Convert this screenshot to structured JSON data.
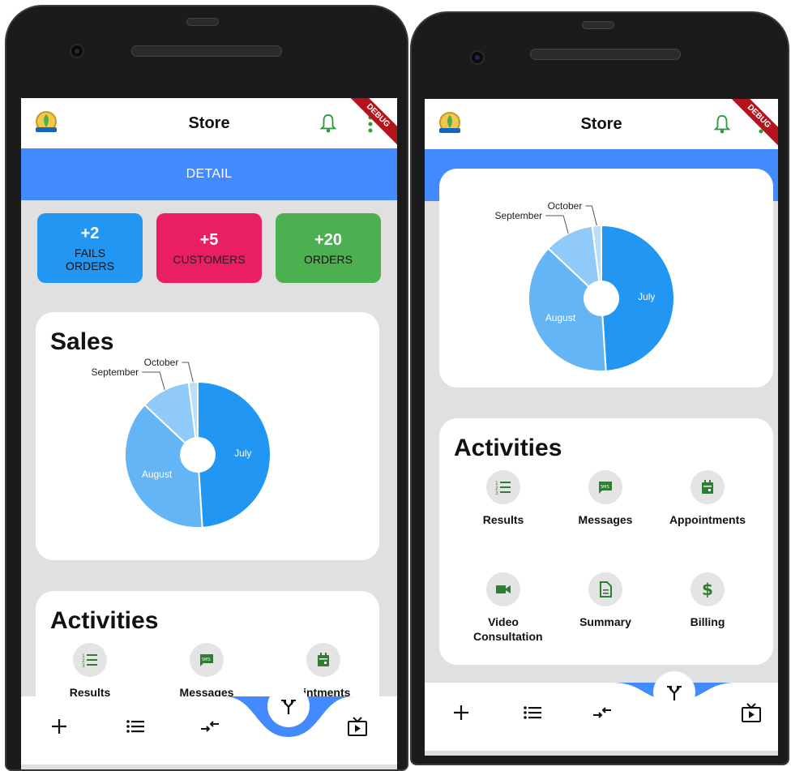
{
  "app": {
    "title": "Store",
    "debug_banner": "DEBUG",
    "detail_tab": "DETAIL"
  },
  "stats": [
    {
      "value": "+2",
      "label": "FAILS ORDERS",
      "color": "#2196f3"
    },
    {
      "value": "+5",
      "label": "CUSTOMERS",
      "color": "#e91e63"
    },
    {
      "value": "+20",
      "label": "ORDERS",
      "color": "#4caf50"
    }
  ],
  "sales": {
    "title": "Sales"
  },
  "chart_data": {
    "type": "pie",
    "title": "Sales",
    "categories": [
      "July",
      "August",
      "September",
      "October"
    ],
    "values": [
      49,
      38,
      11,
      2
    ],
    "colors": [
      "#2196f3",
      "#64b5f6",
      "#90caf9",
      "#bbdefb"
    ],
    "donut_hole": true
  },
  "activities": {
    "title": "Activities",
    "items": [
      {
        "label": "Results",
        "icon": "list-numbered-icon"
      },
      {
        "label": "Messages",
        "icon": "sms-icon"
      },
      {
        "label": "Appointments",
        "icon": "calendar-icon"
      },
      {
        "label": "Video Consultation",
        "icon": "videocam-icon"
      },
      {
        "label": "Summary",
        "icon": "document-icon"
      },
      {
        "label": "Billing",
        "icon": "dollar-icon"
      }
    ]
  },
  "left_partial_labels": [
    "Results",
    "Messages",
    "ointments"
  ],
  "bottom_nav": [
    {
      "icon": "add-icon"
    },
    {
      "icon": "list-icon"
    },
    {
      "icon": "swap-arrows-icon"
    },
    {
      "icon": "fork-icon"
    },
    {
      "icon": "tv-play-icon"
    }
  ],
  "accent_color": "#448aff",
  "icon_green": "#2e7d32"
}
